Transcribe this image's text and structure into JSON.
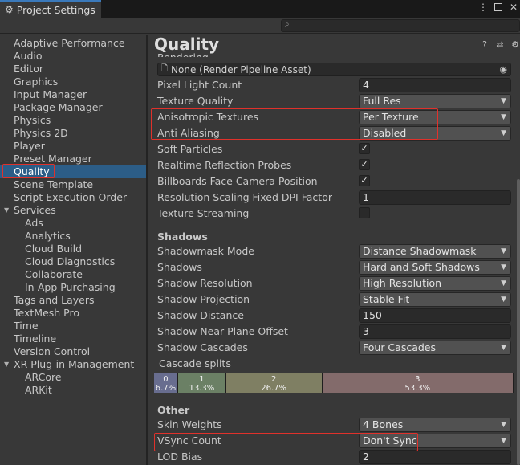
{
  "window": {
    "tab_title": "Project Settings",
    "gear_glyph": "⚙",
    "menu_glyph": "⋮",
    "close_glyph": "✕"
  },
  "search": {
    "value": "",
    "glyph": "🔍"
  },
  "sidebar": {
    "items": [
      {
        "label": "Adaptive Performance"
      },
      {
        "label": "Audio"
      },
      {
        "label": "Editor"
      },
      {
        "label": "Graphics"
      },
      {
        "label": "Input Manager"
      },
      {
        "label": "Package Manager"
      },
      {
        "label": "Physics"
      },
      {
        "label": "Physics 2D"
      },
      {
        "label": "Player"
      },
      {
        "label": "Preset Manager"
      },
      {
        "label": "Quality",
        "selected": true
      },
      {
        "label": "Scene Template"
      },
      {
        "label": "Script Execution Order"
      },
      {
        "label": "Services",
        "expanded": true
      },
      {
        "label": "Ads",
        "sub": true
      },
      {
        "label": "Analytics",
        "sub": true
      },
      {
        "label": "Cloud Build",
        "sub": true
      },
      {
        "label": "Cloud Diagnostics",
        "sub": true
      },
      {
        "label": "Collaborate",
        "sub": true
      },
      {
        "label": "In-App Purchasing",
        "sub": true
      },
      {
        "label": "Tags and Layers"
      },
      {
        "label": "TextMesh Pro"
      },
      {
        "label": "Time"
      },
      {
        "label": "Timeline"
      },
      {
        "label": "Version Control"
      },
      {
        "label": "XR Plug-in Management",
        "expanded": true
      },
      {
        "label": "ARCore",
        "sub": true
      },
      {
        "label": "ARKit",
        "sub": true
      }
    ]
  },
  "main": {
    "title": "Quality",
    "clipped_heading": "Rendering",
    "icons": {
      "help": "?",
      "settings": "⇄",
      "gear": "⚙"
    },
    "render_pipeline_asset": "None (Render Pipeline Asset)",
    "rendering_rows": {
      "pixel_light_count": {
        "label": "Pixel Light Count",
        "value": "4"
      },
      "texture_quality": {
        "label": "Texture Quality",
        "value": "Full Res"
      },
      "anisotropic_textures": {
        "label": "Anisotropic Textures",
        "value": "Per Texture"
      },
      "anti_aliasing": {
        "label": "Anti Aliasing",
        "value": "Disabled"
      },
      "soft_particles": {
        "label": "Soft Particles",
        "checked": true
      },
      "realtime_reflection_probes": {
        "label": "Realtime Reflection Probes",
        "checked": true
      },
      "billboards_face_camera": {
        "label": "Billboards Face Camera Position",
        "checked": true
      },
      "resolution_scaling_dpi": {
        "label": "Resolution Scaling Fixed DPI Factor",
        "value": "1"
      },
      "texture_streaming": {
        "label": "Texture Streaming",
        "checked": false
      }
    },
    "shadows_heading": "Shadows",
    "shadow_rows": {
      "shadowmask_mode": {
        "label": "Shadowmask Mode",
        "value": "Distance Shadowmask"
      },
      "shadows": {
        "label": "Shadows",
        "value": "Hard and Soft Shadows"
      },
      "shadow_resolution": {
        "label": "Shadow Resolution",
        "value": "High Resolution"
      },
      "shadow_projection": {
        "label": "Shadow Projection",
        "value": "Stable Fit"
      },
      "shadow_distance": {
        "label": "Shadow Distance",
        "value": "150"
      },
      "shadow_near_plane": {
        "label": "Shadow Near Plane Offset",
        "value": "3"
      },
      "shadow_cascades": {
        "label": "Shadow Cascades",
        "value": "Four Cascades"
      }
    },
    "cascade_splits": {
      "label": "Cascade splits",
      "segments": [
        {
          "index": "0",
          "percent": "6.7%",
          "fraction": 0.067,
          "color": "#686d8f"
        },
        {
          "index": "1",
          "percent": "13.3%",
          "fraction": 0.133,
          "color": "#6b8065"
        },
        {
          "index": "2",
          "percent": "26.7%",
          "fraction": 0.267,
          "color": "#7f7f63"
        },
        {
          "index": "3",
          "percent": "53.3%",
          "fraction": 0.533,
          "color": "#836b6b"
        }
      ]
    },
    "other_heading": "Other",
    "other_rows": {
      "skin_weights": {
        "label": "Skin Weights",
        "value": "4 Bones"
      },
      "vsync_count": {
        "label": "VSync Count",
        "value": "Don't Sync"
      },
      "lod_bias": {
        "label": "LOD Bias",
        "value": "2"
      }
    },
    "check_glyph": "✓",
    "dropdown_glyph": "▼"
  },
  "colors": {
    "selection": "#2c5d87",
    "highlight_box": "#e0312b",
    "tab_accent": "#3a79bb"
  }
}
